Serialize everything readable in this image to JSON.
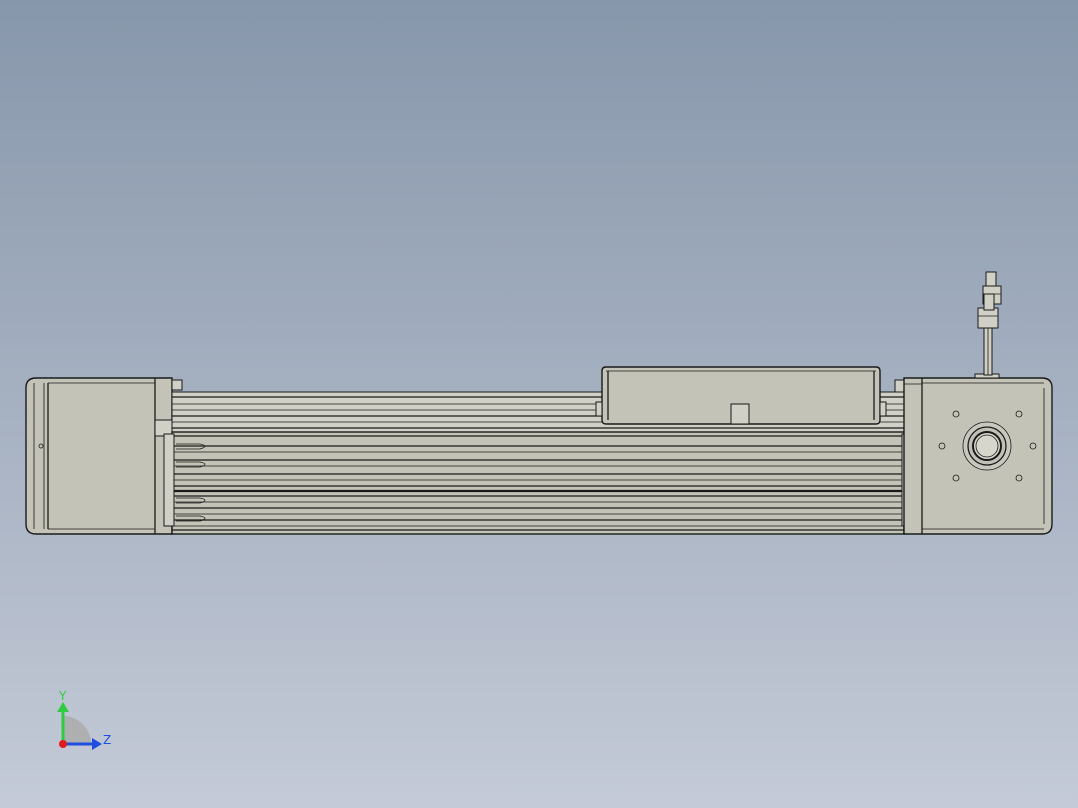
{
  "viewport": {
    "background_top": "#8797ab",
    "background_bottom": "#c4cad7",
    "part_color": "#c3c3b8",
    "edge_color": "#1a1a1a"
  },
  "triad": {
    "y_label": "Y",
    "z_label": "Z",
    "y_color": "#2ecc40",
    "z_color": "#1f4fe0",
    "x_color": "#e01b1b"
  }
}
